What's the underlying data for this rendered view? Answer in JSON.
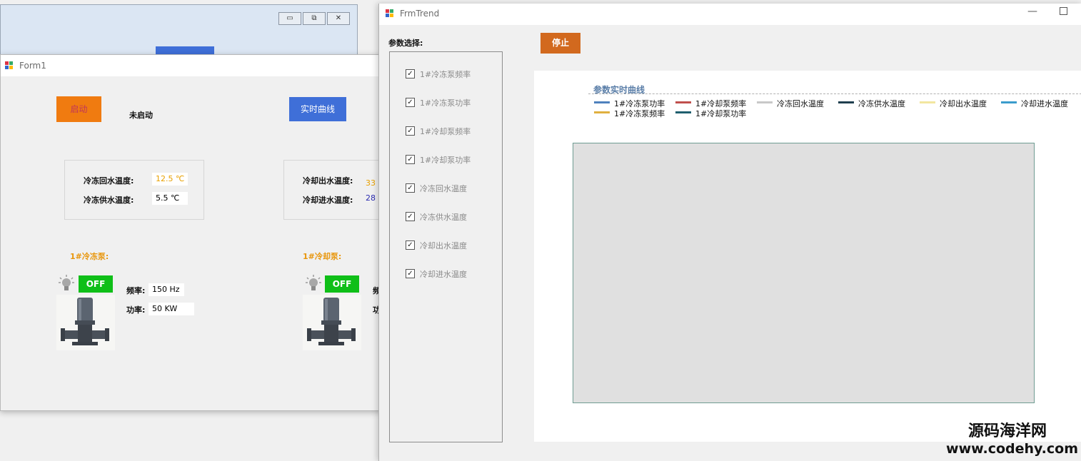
{
  "bg_window": {
    "buttons": [
      "▭",
      "⧉",
      "✕"
    ]
  },
  "form1": {
    "title": "Form1",
    "start_label": "启动",
    "status": "未启动",
    "curve_label": "实时曲线",
    "freeze_return_label": "冷冻回水温度:",
    "freeze_return_value": "12.5 ℃",
    "freeze_supply_label": "冷冻供水温度:",
    "freeze_supply_value": "5.5 ℃",
    "cool_out_label": "冷却出水温度:",
    "cool_out_value": "33",
    "cool_in_label": "冷却进水温度:",
    "cool_in_value": "28",
    "pump1_title": "1#冷冻泵:",
    "pump1_state": "OFF",
    "pump1_freq_label": "频率:",
    "pump1_freq_value": "150 Hz",
    "pump1_power_label": "功率:",
    "pump1_power_value": "50 KW",
    "pump2_title": "1#冷却泵:",
    "pump2_state": "OFF",
    "pump2_freq_label": "频",
    "pump2_power_label": "功"
  },
  "trend": {
    "title": "FrmTrend",
    "param_label": "参数选择:",
    "stop_label": "停止",
    "params": [
      {
        "label": "1#冷冻泵频率",
        "checked": true
      },
      {
        "label": "1#冷冻泵功率",
        "checked": true
      },
      {
        "label": "1#冷却泵频率",
        "checked": true
      },
      {
        "label": "1#冷却泵功率",
        "checked": true
      },
      {
        "label": "冷冻回水温度",
        "checked": true
      },
      {
        "label": "冷冻供水温度",
        "checked": true
      },
      {
        "label": "冷却出水温度",
        "checked": true
      },
      {
        "label": "冷却进水温度",
        "checked": true
      }
    ],
    "chart_title": "参数实时曲线",
    "legend": [
      {
        "name": "1#冷冻泵功率",
        "color": "#4f81bd"
      },
      {
        "name": "1#冷却泵频率",
        "color": "#c0504d"
      },
      {
        "name": "冷冻回水温度",
        "color": "#c8c8c8"
      },
      {
        "name": "冷冻供水温度",
        "color": "#1f3f4f"
      },
      {
        "name": "冷却出水温度",
        "color": "#f2e6a0"
      },
      {
        "name": "冷却进水温度",
        "color": "#3b9ccc"
      },
      {
        "name": "1#冷冻泵频率",
        "color": "#e0b040"
      },
      {
        "name": "1#冷却泵功率",
        "color": "#1f5f6f"
      }
    ]
  },
  "watermark": {
    "line1": "源码海洋网",
    "line2": "www.codehy.com"
  },
  "colors": {
    "start_button": "#f07b10",
    "curve_button": "#3f6fd8",
    "stop_button": "#d2691e",
    "off_indicator": "#0fbf18"
  }
}
